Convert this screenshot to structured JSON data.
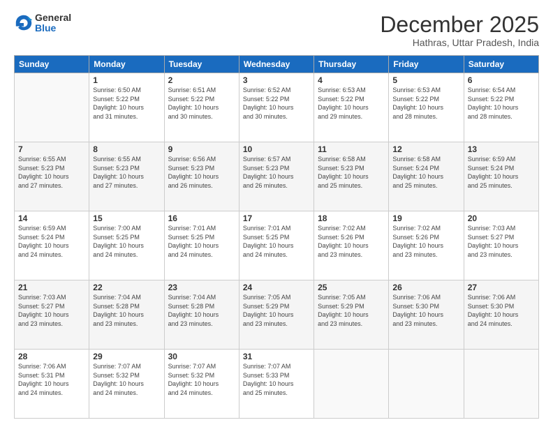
{
  "header": {
    "logo_general": "General",
    "logo_blue": "Blue",
    "month_title": "December 2025",
    "location": "Hathras, Uttar Pradesh, India"
  },
  "weekdays": [
    "Sunday",
    "Monday",
    "Tuesday",
    "Wednesday",
    "Thursday",
    "Friday",
    "Saturday"
  ],
  "weeks": [
    [
      {
        "day": "",
        "info": ""
      },
      {
        "day": "1",
        "info": "Sunrise: 6:50 AM\nSunset: 5:22 PM\nDaylight: 10 hours\nand 31 minutes."
      },
      {
        "day": "2",
        "info": "Sunrise: 6:51 AM\nSunset: 5:22 PM\nDaylight: 10 hours\nand 30 minutes."
      },
      {
        "day": "3",
        "info": "Sunrise: 6:52 AM\nSunset: 5:22 PM\nDaylight: 10 hours\nand 30 minutes."
      },
      {
        "day": "4",
        "info": "Sunrise: 6:53 AM\nSunset: 5:22 PM\nDaylight: 10 hours\nand 29 minutes."
      },
      {
        "day": "5",
        "info": "Sunrise: 6:53 AM\nSunset: 5:22 PM\nDaylight: 10 hours\nand 28 minutes."
      },
      {
        "day": "6",
        "info": "Sunrise: 6:54 AM\nSunset: 5:22 PM\nDaylight: 10 hours\nand 28 minutes."
      }
    ],
    [
      {
        "day": "7",
        "info": "Sunrise: 6:55 AM\nSunset: 5:23 PM\nDaylight: 10 hours\nand 27 minutes."
      },
      {
        "day": "8",
        "info": "Sunrise: 6:55 AM\nSunset: 5:23 PM\nDaylight: 10 hours\nand 27 minutes."
      },
      {
        "day": "9",
        "info": "Sunrise: 6:56 AM\nSunset: 5:23 PM\nDaylight: 10 hours\nand 26 minutes."
      },
      {
        "day": "10",
        "info": "Sunrise: 6:57 AM\nSunset: 5:23 PM\nDaylight: 10 hours\nand 26 minutes."
      },
      {
        "day": "11",
        "info": "Sunrise: 6:58 AM\nSunset: 5:23 PM\nDaylight: 10 hours\nand 25 minutes."
      },
      {
        "day": "12",
        "info": "Sunrise: 6:58 AM\nSunset: 5:24 PM\nDaylight: 10 hours\nand 25 minutes."
      },
      {
        "day": "13",
        "info": "Sunrise: 6:59 AM\nSunset: 5:24 PM\nDaylight: 10 hours\nand 25 minutes."
      }
    ],
    [
      {
        "day": "14",
        "info": "Sunrise: 6:59 AM\nSunset: 5:24 PM\nDaylight: 10 hours\nand 24 minutes."
      },
      {
        "day": "15",
        "info": "Sunrise: 7:00 AM\nSunset: 5:25 PM\nDaylight: 10 hours\nand 24 minutes."
      },
      {
        "day": "16",
        "info": "Sunrise: 7:01 AM\nSunset: 5:25 PM\nDaylight: 10 hours\nand 24 minutes."
      },
      {
        "day": "17",
        "info": "Sunrise: 7:01 AM\nSunset: 5:25 PM\nDaylight: 10 hours\nand 24 minutes."
      },
      {
        "day": "18",
        "info": "Sunrise: 7:02 AM\nSunset: 5:26 PM\nDaylight: 10 hours\nand 23 minutes."
      },
      {
        "day": "19",
        "info": "Sunrise: 7:02 AM\nSunset: 5:26 PM\nDaylight: 10 hours\nand 23 minutes."
      },
      {
        "day": "20",
        "info": "Sunrise: 7:03 AM\nSunset: 5:27 PM\nDaylight: 10 hours\nand 23 minutes."
      }
    ],
    [
      {
        "day": "21",
        "info": "Sunrise: 7:03 AM\nSunset: 5:27 PM\nDaylight: 10 hours\nand 23 minutes."
      },
      {
        "day": "22",
        "info": "Sunrise: 7:04 AM\nSunset: 5:28 PM\nDaylight: 10 hours\nand 23 minutes."
      },
      {
        "day": "23",
        "info": "Sunrise: 7:04 AM\nSunset: 5:28 PM\nDaylight: 10 hours\nand 23 minutes."
      },
      {
        "day": "24",
        "info": "Sunrise: 7:05 AM\nSunset: 5:29 PM\nDaylight: 10 hours\nand 23 minutes."
      },
      {
        "day": "25",
        "info": "Sunrise: 7:05 AM\nSunset: 5:29 PM\nDaylight: 10 hours\nand 23 minutes."
      },
      {
        "day": "26",
        "info": "Sunrise: 7:06 AM\nSunset: 5:30 PM\nDaylight: 10 hours\nand 23 minutes."
      },
      {
        "day": "27",
        "info": "Sunrise: 7:06 AM\nSunset: 5:30 PM\nDaylight: 10 hours\nand 24 minutes."
      }
    ],
    [
      {
        "day": "28",
        "info": "Sunrise: 7:06 AM\nSunset: 5:31 PM\nDaylight: 10 hours\nand 24 minutes."
      },
      {
        "day": "29",
        "info": "Sunrise: 7:07 AM\nSunset: 5:32 PM\nDaylight: 10 hours\nand 24 minutes."
      },
      {
        "day": "30",
        "info": "Sunrise: 7:07 AM\nSunset: 5:32 PM\nDaylight: 10 hours\nand 24 minutes."
      },
      {
        "day": "31",
        "info": "Sunrise: 7:07 AM\nSunset: 5:33 PM\nDaylight: 10 hours\nand 25 minutes."
      },
      {
        "day": "",
        "info": ""
      },
      {
        "day": "",
        "info": ""
      },
      {
        "day": "",
        "info": ""
      }
    ]
  ]
}
